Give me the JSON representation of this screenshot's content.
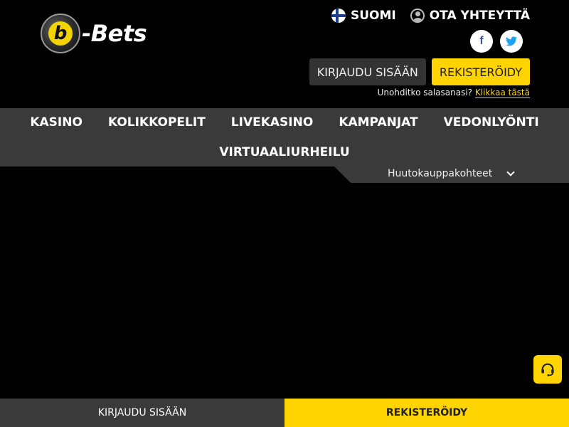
{
  "brand": {
    "logo_letter": "b",
    "logo_text": "-Bets",
    "accent_color": "#ffd400"
  },
  "top_links": {
    "language": "SUOMI",
    "contact": "OTA YHTEYTTÄ"
  },
  "socials": [
    {
      "icon": "facebook-icon",
      "glyph": "f"
    },
    {
      "icon": "twitter-icon",
      "glyph": "🐦"
    }
  ],
  "auth": {
    "login_label": "KIRJAUDU SISÄÄN",
    "register_label": "REKISTERÖIDY",
    "forgot_text": "Unohditko salasanasi?",
    "forgot_link": "Klikkaa tästä"
  },
  "nav": {
    "items": [
      "KASINO",
      "KOLIKKOPELIT",
      "LIVEKASINO",
      "KAMPANJAT",
      "VEDONLYÖNTI",
      "VIRTUAALIURHEILU"
    ]
  },
  "auction": {
    "label": "Huutokauppakohteet"
  },
  "bottom_bar": {
    "login_label": "KIRJAUDU SISÄÄN",
    "register_label": "REKISTERÖIDY"
  }
}
